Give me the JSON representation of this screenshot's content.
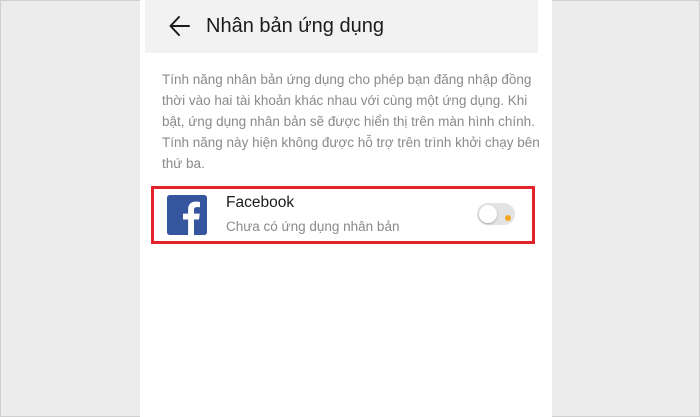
{
  "header": {
    "back_icon": "arrow-left-icon",
    "title": "Nhân bản ứng dụng"
  },
  "description": "Tính năng nhân bản ứng dụng cho phép bạn đăng nhập đồng thời vào hai tài khoản khác nhau với cùng một ứng dụng. Khi bật, ứng dụng nhân bản sẽ được hiển thị trên màn hình chính. Tính năng này hiện không được hỗ trợ trên trình khởi chạy bên thứ ba.",
  "apps": [
    {
      "name": "Facebook",
      "status": "Chưa có ứng dụng nhân bản",
      "icon": "facebook-icon",
      "toggle_on": false
    }
  ],
  "colors": {
    "highlight_border": "#e3222a",
    "facebook_blue": "#35559f",
    "toggle_off": "#e3e3e3",
    "toggle_dot": "#f5a623",
    "secondary_text": "#8a8a8a"
  }
}
